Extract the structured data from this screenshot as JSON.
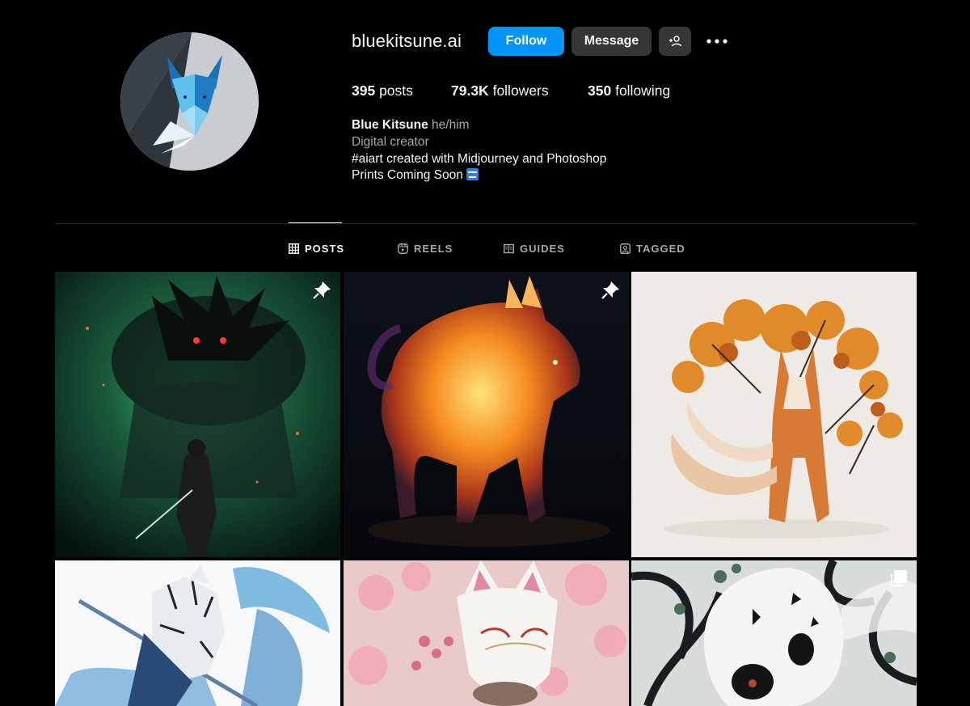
{
  "profile": {
    "username": "bluekitsune.ai",
    "follow_label": "Follow",
    "message_label": "Message",
    "suggest_icon": "person-add-icon",
    "more_icon": "more-horizontal-icon",
    "avatar_icon": "geometric-fox-logo"
  },
  "stats": {
    "posts_count": "395",
    "posts_label": "posts",
    "followers_count": "79.3K",
    "followers_label": "followers",
    "following_count": "350",
    "following_label": "following"
  },
  "bio": {
    "name": "Blue Kitsune",
    "pronouns": "he/him",
    "category": "Digital creator",
    "line1": "#aiart created with Midjourney and Photoshop",
    "line2": "Prints Coming Soon",
    "line2_icon": "soon-arrow-emoji"
  },
  "tabs": [
    {
      "label": "POSTS",
      "icon": "grid-icon",
      "active": true
    },
    {
      "label": "REELS",
      "icon": "reels-icon",
      "active": false
    },
    {
      "label": "GUIDES",
      "icon": "guides-icon",
      "active": false
    },
    {
      "label": "TAGGED",
      "icon": "tagged-icon",
      "active": false
    }
  ],
  "posts": [
    {
      "subject": "dark figure over warrior with green flames",
      "pinned": true,
      "multi": false
    },
    {
      "subject": "fire wolf",
      "pinned": true,
      "multi": false
    },
    {
      "subject": "autumn leaf fox",
      "pinned": false,
      "multi": false
    },
    {
      "subject": "white tiger samurai with water splash",
      "pinned": false,
      "multi": false
    },
    {
      "subject": "kitsune mask with cherry blossoms",
      "pinned": false,
      "multi": false
    },
    {
      "subject": "white skull with black branches",
      "pinned": false,
      "multi": true
    }
  ],
  "colors": {
    "background": "#000000",
    "accent": "#0095f6",
    "button_secondary": "#363636",
    "muted_text": "#a8a8a8"
  }
}
